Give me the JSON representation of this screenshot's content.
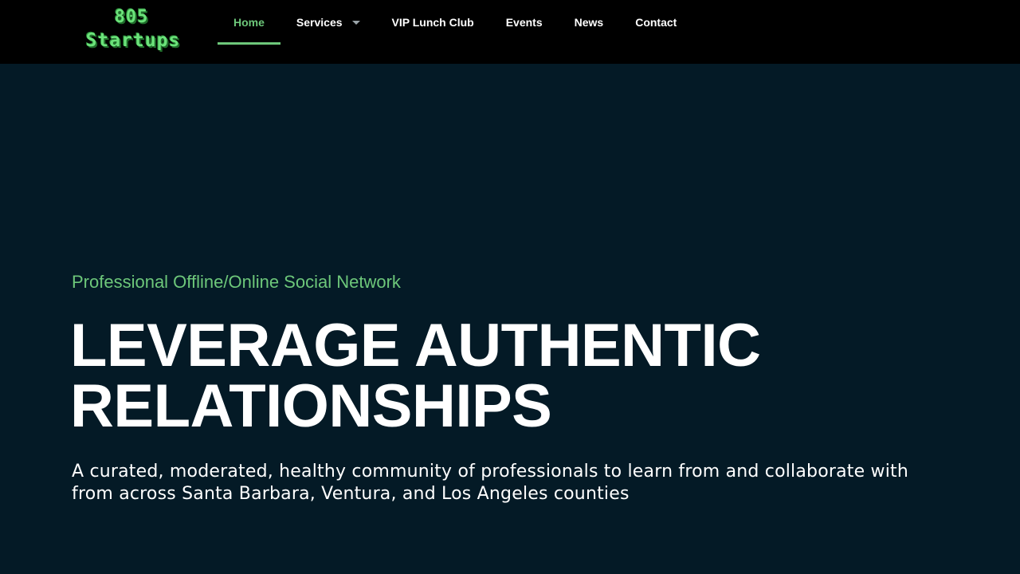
{
  "header": {
    "logo": {
      "line1": "805",
      "line2": "Startups"
    },
    "nav": [
      {
        "label": "Home",
        "active": true
      },
      {
        "label": "Services",
        "has_dropdown": true,
        "dropdown_icon": "caret-down-icon"
      },
      {
        "label": "VIP Lunch Club"
      },
      {
        "label": "Events"
      },
      {
        "label": "News"
      },
      {
        "label": "Contact"
      }
    ]
  },
  "hero": {
    "subtitle": "Professional Offline/Online Social Network",
    "title_line1": "LEVERAGE AUTHENTIC",
    "title_line2": "RELATIONSHIPS",
    "description": "A curated, moderated, healthy community of professionals to learn from and collaborate with from across Santa Barbara, Ventura, and Los Angeles counties"
  },
  "colors": {
    "header_bg": "#000000",
    "page_bg": "#041a26",
    "accent": "#6dc77a",
    "logo_green": "#6be27a",
    "text": "#ffffff"
  }
}
